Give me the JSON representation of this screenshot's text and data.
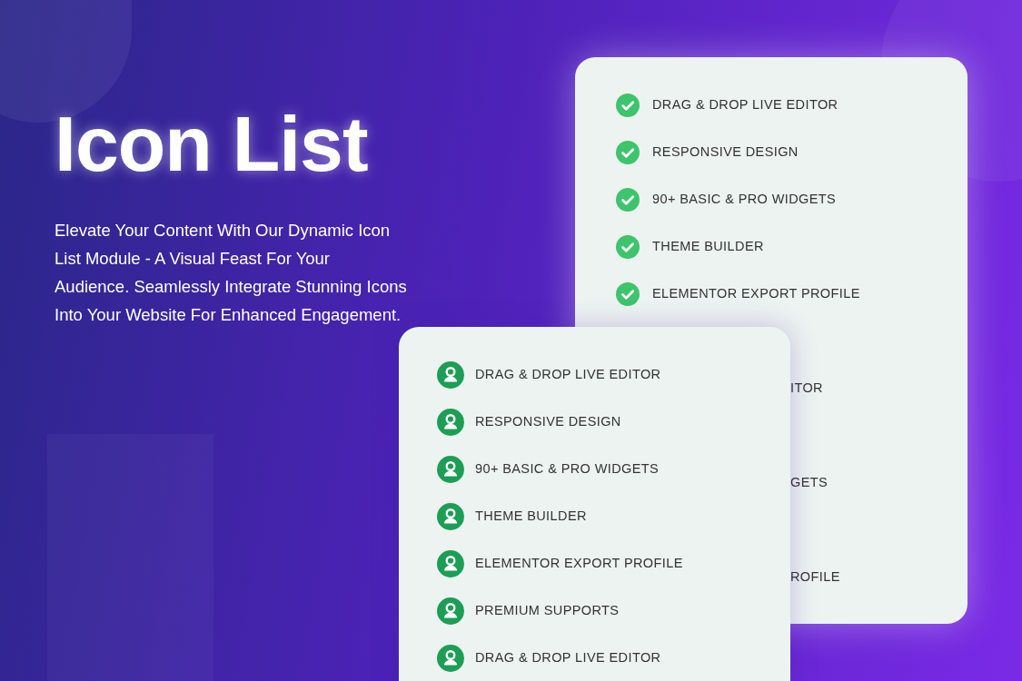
{
  "hero": {
    "title": "Icon List",
    "description": "Elevate Your Content With Our Dynamic Icon List Module - A Visual Feast For Your Audience. Seamlessly Integrate Stunning Icons Into Your Website For Enhanced Engagement."
  },
  "back_card": {
    "items": [
      {
        "label": "DRAG & DROP LIVE EDITOR",
        "kind": "full"
      },
      {
        "label": "RESPONSIVE DESIGN",
        "kind": "full"
      },
      {
        "label": "90+ BASIC & PRO WIDGETS",
        "kind": "full"
      },
      {
        "label": "THEME BUILDER",
        "kind": "full"
      },
      {
        "label": "ELEMENTOR EXPORT PROFILE",
        "kind": "full"
      },
      {
        "label": "ITOR",
        "kind": "fragment"
      },
      {
        "label": "GETS",
        "kind": "fragment"
      },
      {
        "label": "ROFILE",
        "kind": "fragment"
      }
    ]
  },
  "front_card": {
    "items": [
      {
        "label": "DRAG & DROP LIVE EDITOR"
      },
      {
        "label": "RESPONSIVE DESIGN"
      },
      {
        "label": "90+ BASIC & PRO WIDGETS"
      },
      {
        "label": "THEME BUILDER"
      },
      {
        "label": "ELEMENTOR EXPORT PROFILE"
      },
      {
        "label": "PREMIUM SUPPORTS"
      },
      {
        "label": "DRAG & DROP LIVE EDITOR"
      }
    ]
  }
}
